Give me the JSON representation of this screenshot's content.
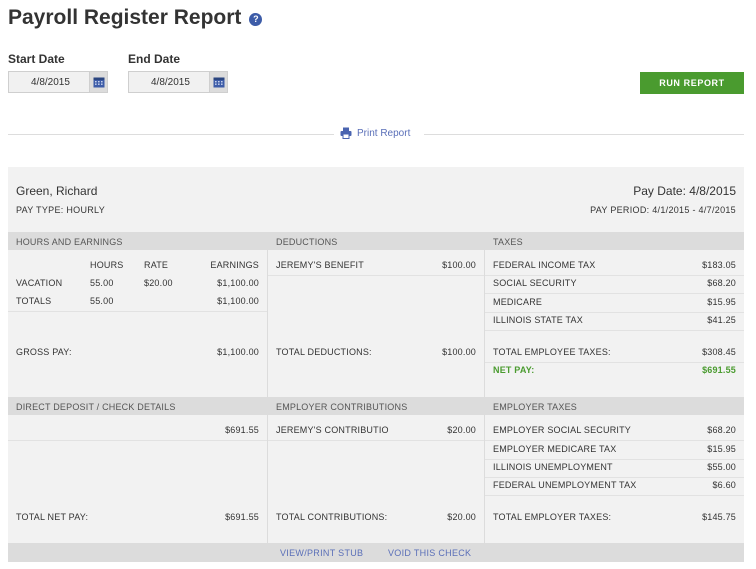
{
  "page": {
    "title": "Payroll Register Report",
    "help_icon": "?"
  },
  "filters": {
    "start_label": "Start Date",
    "start_value": "4/8/2015",
    "end_label": "End Date",
    "end_value": "4/8/2015",
    "run_label": "RUN REPORT"
  },
  "print_label": "Print Report",
  "employee": {
    "name": "Green, Richard",
    "pay_type": "PAY TYPE: HOURLY",
    "pay_date": "Pay Date: 4/8/2015",
    "pay_period": "PAY PERIOD: 4/1/2015 - 4/7/2015"
  },
  "earnings": {
    "header": "HOURS AND EARNINGS",
    "col_hours": "HOURS",
    "col_rate": "RATE",
    "col_earnings": "EARNINGS",
    "rows": [
      {
        "label": "VACATION",
        "hours": "55.00",
        "rate": "$20.00",
        "earnings": "$1,100.00"
      },
      {
        "label": "TOTALS",
        "hours": "55.00",
        "rate": "",
        "earnings": "$1,100.00"
      }
    ],
    "gross_label": "GROSS PAY:",
    "gross_value": "$1,100.00"
  },
  "deductions": {
    "header": "DEDUCTIONS",
    "items": [
      {
        "label": "JEREMY'S BENEFIT",
        "value": "$100.00"
      }
    ],
    "total_label": "TOTAL DEDUCTIONS:",
    "total_value": "$100.00"
  },
  "taxes": {
    "header": "TAXES",
    "items": [
      {
        "label": "FEDERAL INCOME TAX",
        "value": "$183.05"
      },
      {
        "label": "SOCIAL SECURITY",
        "value": "$68.20"
      },
      {
        "label": "MEDICARE",
        "value": "$15.95"
      },
      {
        "label": "ILLINOIS STATE TAX",
        "value": "$41.25"
      }
    ],
    "total_label": "TOTAL EMPLOYEE TAXES:",
    "total_value": "$308.45",
    "net_label": "NET PAY:",
    "net_value": "$691.55"
  },
  "direct_deposit": {
    "header": "DIRECT DEPOSIT / CHECK DETAILS",
    "amount": "$691.55",
    "total_label": "TOTAL NET PAY:",
    "total_value": "$691.55"
  },
  "employer_contributions": {
    "header": "EMPLOYER CONTRIBUTIONS",
    "items": [
      {
        "label": "JEREMY'S CONTRIBUTIO",
        "value": "$20.00"
      }
    ],
    "total_label": "TOTAL CONTRIBUTIONS:",
    "total_value": "$20.00"
  },
  "employer_taxes": {
    "header": "EMPLOYER TAXES",
    "items": [
      {
        "label": "EMPLOYER SOCIAL SECURITY",
        "value": "$68.20"
      },
      {
        "label": "EMPLOYER MEDICARE TAX",
        "value": "$15.95"
      },
      {
        "label": "ILLINOIS UNEMPLOYMENT",
        "value": "$55.00"
      },
      {
        "label": "FEDERAL UNEMPLOYMENT TAX",
        "value": "$6.60"
      }
    ],
    "total_label": "TOTAL EMPLOYER TAXES:",
    "total_value": "$145.75"
  },
  "footer": {
    "view_stub": "VIEW/PRINT STUB",
    "void_check": "VOID THIS CHECK"
  },
  "colors": {
    "accent_green": "#4a9b2f",
    "link_blue": "#5a6fb8",
    "help_blue": "#3d5ca8"
  }
}
